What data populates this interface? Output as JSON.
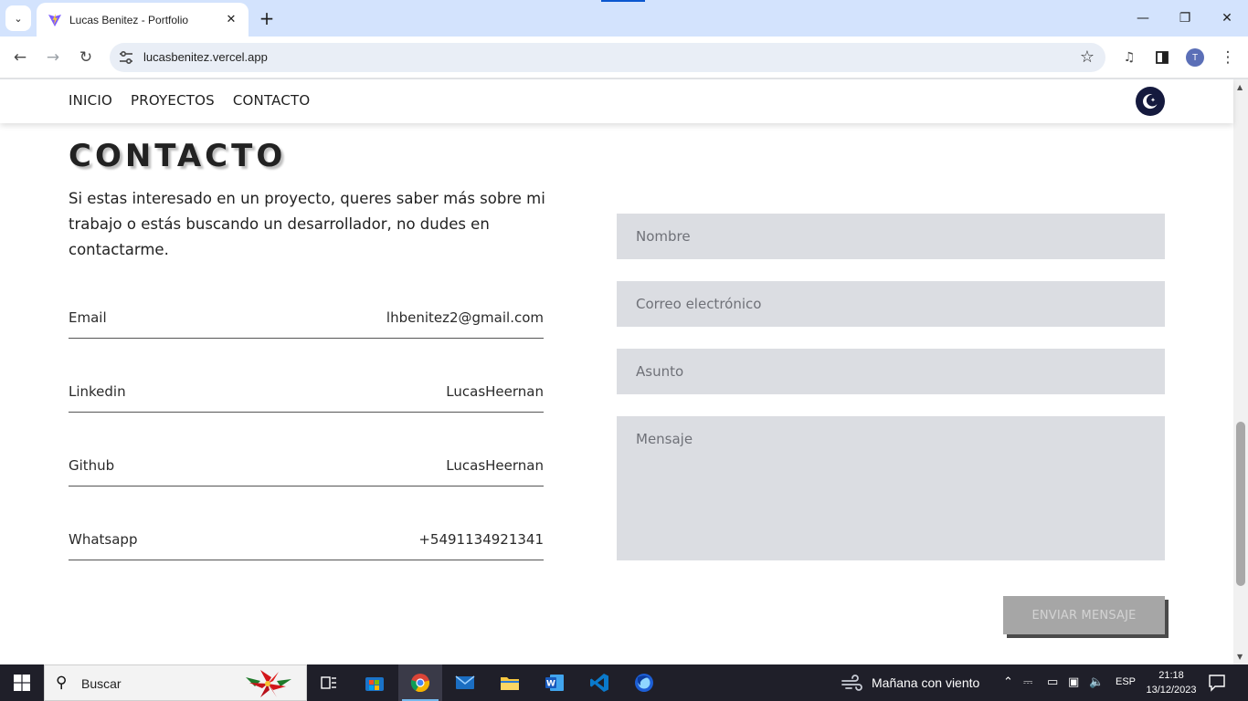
{
  "browser": {
    "tab_title": "Lucas Benitez - Portfolio",
    "url": "lucasbenitez.vercel.app",
    "profile_initial": "T"
  },
  "nav": {
    "items": [
      "INICIO",
      "PROYECTOS",
      "CONTACTO"
    ]
  },
  "contact": {
    "title": "CONTACTO",
    "intro": "Si estas interesado en un proyecto, queres saber más sobre mi trabajo o estás buscando un desarrollador, no dudes en contactarme.",
    "rows": [
      {
        "label": "Email",
        "value": "lhbenitez2@gmail.com"
      },
      {
        "label": "Linkedin",
        "value": "LucasHeernan"
      },
      {
        "label": "Github",
        "value": "LucasHeernan"
      },
      {
        "label": "Whatsapp",
        "value": "+5491134921341"
      }
    ]
  },
  "form": {
    "name_placeholder": "Nombre",
    "email_placeholder": "Correo electrónico",
    "subject_placeholder": "Asunto",
    "message_placeholder": "Mensaje",
    "submit_label": "ENVIAR MENSAJE"
  },
  "taskbar": {
    "search_placeholder": "Buscar",
    "weather": "Mañana con viento",
    "language": "ESP",
    "time": "21:18",
    "date": "13/12/2023",
    "apps": [
      "task-view",
      "microsoft-store",
      "chrome",
      "mail",
      "file-explorer",
      "word",
      "vscode",
      "firefox-dev"
    ]
  },
  "colors": {
    "field_bg": "#dbdde2",
    "button_bg": "#a6a6a6",
    "theme_toggle": "#151a3e",
    "taskbar": "#1f1f29"
  }
}
